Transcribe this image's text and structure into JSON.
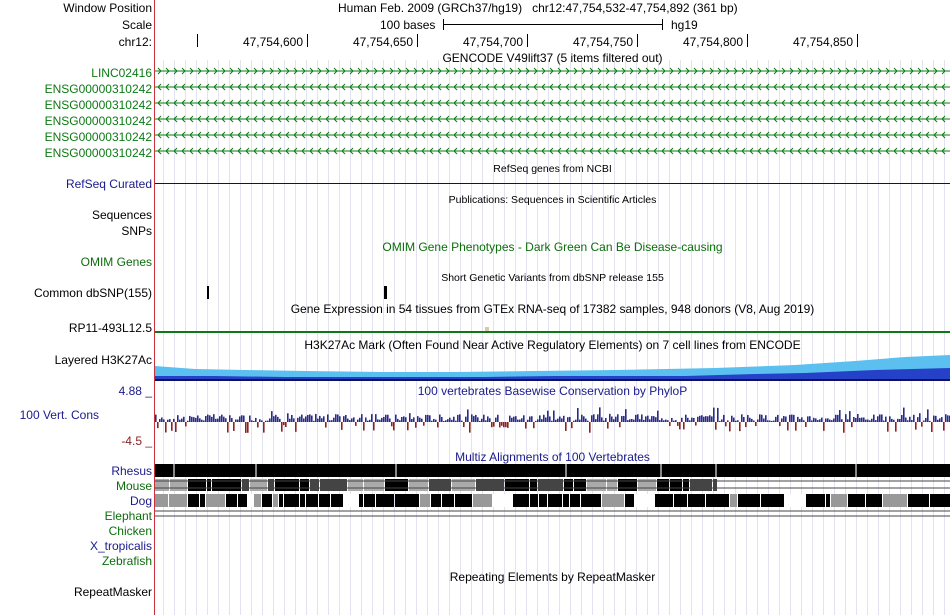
{
  "header": {
    "window_position_label": "Window Position",
    "scale_label": "Scale",
    "chrom_label": "chr12:",
    "assembly": "Human Feb. 2009 (GRCh37/hg19)",
    "position": "chr12:47,754,532-47,754,892 (361 bp)",
    "scale_text": "100 bases",
    "db": "hg19",
    "ruler_ticks": [
      "47,754,600",
      "47,754,650",
      "47,754,700",
      "47,754,750",
      "47,754,800",
      "47,754,850"
    ]
  },
  "tracks": {
    "gencode_title": "GENCODE V49lift37 (5 items filtered out)",
    "gencode_items": [
      {
        "name": "LINC02416",
        "strand": "+"
      },
      {
        "name": "ENSG00000310242",
        "strand": "-"
      },
      {
        "name": "ENSG00000310242",
        "strand": "-"
      },
      {
        "name": "ENSG00000310242",
        "strand": "-"
      },
      {
        "name": "ENSG00000310242",
        "strand": "-"
      },
      {
        "name": "ENSG00000310242",
        "strand": "-"
      }
    ],
    "refseq_title": "RefSeq genes from NCBI",
    "refseq_label": "RefSeq Curated",
    "pubs_title": "Publications: Sequences in Scientific Articles",
    "sequences_label": "Sequences",
    "snps_label": "SNPs",
    "omim_title": "OMIM Gene Phenotypes - Dark Green Can Be Disease-causing",
    "omim_label": "OMIM Genes",
    "dbsnp_title": "Short Genetic Variants from dbSNP release 155",
    "dbsnp_label": "Common dbSNP(155)",
    "gtex_title": "Gene Expression in 54 tissues from GTEx RNA-seq of 17382 samples, 948 donors (V8, Aug 2019)",
    "gtex_label": "RP11-493L12.5",
    "h3k27ac_title": "H3K27Ac Mark (Often Found Near Active Regulatory Elements) on 7 cell lines from ENCODE",
    "h3k27ac_label": "Layered H3K27Ac",
    "cons_title": "100 vertebrates Basewise Conservation by PhyloP",
    "cons_label": "100 Vert. Cons",
    "cons_max": "4.88 _",
    "cons_min": "-4.5 _",
    "multiz_title": "Multiz Alignments of 100 Vertebrates",
    "species": [
      "Rhesus",
      "Mouse",
      "Dog",
      "Elephant",
      "Chicken",
      "X_tropicalis",
      "Zebrafish"
    ],
    "repeat_title": "Repeating Elements by RepeatMasker",
    "repeat_label": "RepeatMasker"
  },
  "colors": {
    "gencode": "#0b7a14",
    "label_blue": "#1a1a8c",
    "refseq": "#0c0c78",
    "omim": "#0b6e0b",
    "cons_pos": "#2a2a8a",
    "cons_neg": "#8b2222",
    "h3_light": "#5bc0f0",
    "h3_dark": "#2541c8",
    "h3_navy": "#101060"
  }
}
